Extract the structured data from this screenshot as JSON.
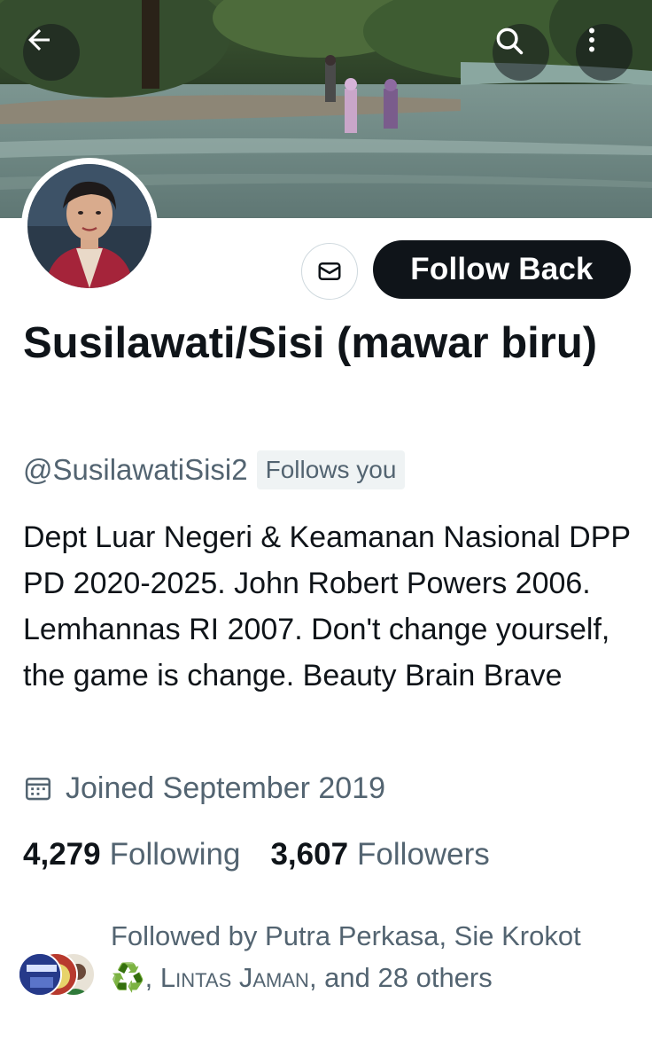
{
  "banner": {
    "back_icon": "arrow-left-icon",
    "search_icon": "search-icon",
    "more_icon": "more-vertical-icon"
  },
  "profile": {
    "display_name": "Susilawati/Sisi (mawar biru)",
    "handle": "@SusilawatiSisi2",
    "follows_you": "Follows you",
    "bio": "Dept Luar Negeri & Keamanan Nasional DPP PD 2020-2025. John Robert Powers 2006. Lemhannas RI 2007. Don't change yourself, the game is change. Beauty Brain Brave",
    "joined": "Joined September 2019"
  },
  "actions": {
    "message_icon": "mail-icon",
    "follow_back": "Follow Back"
  },
  "stats": {
    "following_count": "4,279",
    "following_label": "Following",
    "followers_count": "3,607",
    "followers_label": "Followers"
  },
  "followed_by": {
    "prefix": "Followed by Putra Perkasa, Sie Krokot",
    "emoji": "♻️",
    "sep": ",",
    "name3": "Lintas Jaman",
    "suffix": ", and 28 others"
  },
  "colors": {
    "text_primary": "#0f1419",
    "text_secondary": "#536471",
    "button_dark": "#0f1419",
    "badge_bg": "#eff3f4"
  }
}
